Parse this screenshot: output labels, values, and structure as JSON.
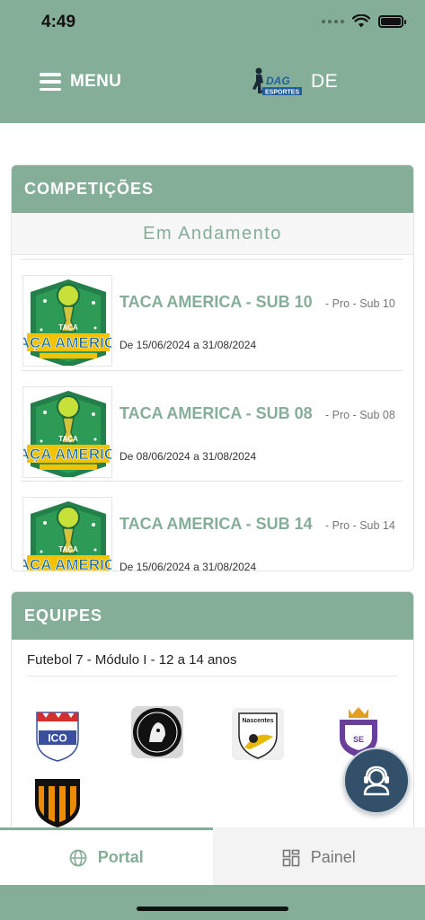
{
  "status": {
    "time": "4:49"
  },
  "header": {
    "menu_label": "MENU",
    "brand_suffix": "DE",
    "brand_logo_text": "DAG ESPORTES"
  },
  "competitions": {
    "title": "COMPETIÇÕES",
    "subtitle": "Em Andamento",
    "items": [
      {
        "title": "TACA AMERICA - SUB 10",
        "category": "- Pro - Sub 10",
        "dates": "De 15/06/2024 a 31/08/2024",
        "logo_text": "TAÇA AMERICA"
      },
      {
        "title": "TACA AMERICA - SUB 08",
        "category": "- Pro - Sub 08",
        "dates": "De 08/06/2024 a 31/08/2024",
        "logo_text": "TAÇA AMERICA"
      },
      {
        "title": "TACA AMERICA - SUB 14",
        "category": "- Pro - Sub 14",
        "dates": "De 15/06/2024 a 31/08/2024",
        "logo_text": "TAÇA AMERICA"
      }
    ]
  },
  "teams": {
    "title": "EQUIPES",
    "module": "Futebol 7 - Módulo I - 12 a 14 anos",
    "logos": [
      "ICO crest",
      "Soccer club crest",
      "Nascentes crest",
      "Purple crown crest",
      "Orange striped crest"
    ]
  },
  "tabs": [
    {
      "label": "Portal",
      "icon": "globe-icon",
      "active": true
    },
    {
      "label": "Painel",
      "icon": "grid-icon",
      "active": false
    }
  ],
  "colors": {
    "primary": "#85ae98",
    "fab": "#33506a",
    "title_green": "#85ae98"
  }
}
